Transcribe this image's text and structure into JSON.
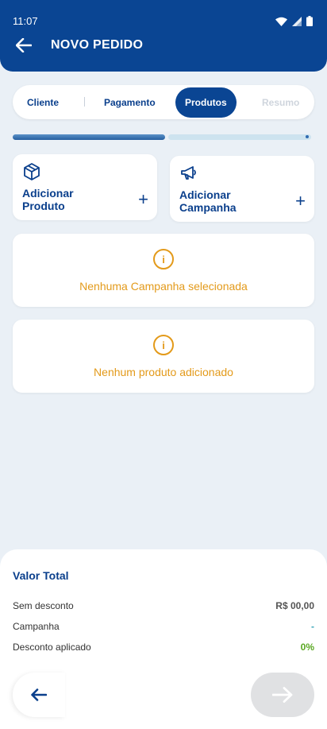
{
  "status_bar": {
    "time": "11:07"
  },
  "header": {
    "title": "NOVO PEDIDO"
  },
  "steps": [
    {
      "label": "Cliente"
    },
    {
      "label": "Pagamento"
    },
    {
      "label": "Produtos"
    },
    {
      "label": "Resumo"
    }
  ],
  "step_separator": "|",
  "progress": {
    "completed_fraction": 0.5
  },
  "actions": {
    "add_product": {
      "line1": "Adicionar",
      "line2": "Produto",
      "plus": "+"
    },
    "add_campaign": {
      "line1": "Adicionar",
      "line2": "Campanha",
      "plus": "+"
    }
  },
  "notices": {
    "campaign": {
      "icon_text": "i",
      "text": "Nenhuma Campanha selecionada"
    },
    "product": {
      "icon_text": "i",
      "text": "Nenhum produto adicionado"
    }
  },
  "summary": {
    "title": "Valor Total",
    "rows": [
      {
        "label": "Sem desconto",
        "value": "R$ 00,00"
      },
      {
        "label": "Campanha",
        "value": "-"
      },
      {
        "label": "Desconto aplicado",
        "value": "0%"
      }
    ]
  },
  "colors": {
    "primary": "#0a4593",
    "warning": "#e39a1a",
    "success": "#5aa822",
    "accent": "#3aa6b8"
  }
}
